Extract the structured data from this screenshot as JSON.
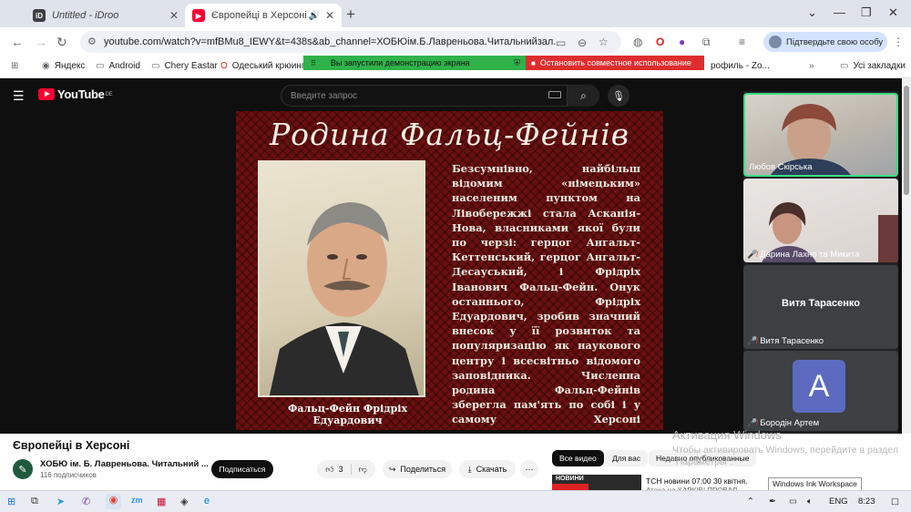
{
  "browser": {
    "tabs": [
      {
        "title": "Untitled - iDroo",
        "favicon_color": "#3c4043"
      },
      {
        "title": "Європейці в Херсоні - YouTube",
        "favicon_color": "#ff0033"
      }
    ],
    "url": "youtube.com/watch?v=mfBMu8_IEWY&t=438s&ab_channel=ХОБЮім.Б.Лавреньова.Читальнийзал.",
    "verify_label": "Підтвердьте свою особу",
    "bookmarks": [
      "Яндекс",
      "Android",
      "Chery Eastar",
      "Одеський крюинг",
      "рофиль - Zo...",
      "Усі закладки"
    ]
  },
  "share_bar": {
    "status": "Вы запустили демонстрацию экрана",
    "stop": "Остановить совместное использование",
    "status_color": "#2fb24a",
    "stop_color": "#de2d2d"
  },
  "youtube": {
    "logo": "YouTube",
    "region": "DE",
    "search_placeholder": "Введите запрос",
    "video_title": "Європейці в Херсоні",
    "channel": "ХОБЮ ім. Б. Лавреньова. Читальний ...",
    "subscribers": "116 подписчиков",
    "subscribe": "Подписаться",
    "likes": "3",
    "share": "Поделиться",
    "download": "Скачать",
    "chips": [
      "Все видео",
      "Для вас",
      "Недавно опубликованные"
    ],
    "rec_thumb_label": "НОВИНИ",
    "rec_title": "ТСН новини 07:00 30 квітня.",
    "rec_sub": "Атака на ХАРКІВ! ПРОВАЛ"
  },
  "slide": {
    "title": "Родина Фальц-Фейнів",
    "text": "Безсумнівно, найбільш відомим «німецьким» населеним пунктом на Лівобережжі стала Асканія-Нова, власниками якої були по черзі: герцог Ангальт-Кеттенський, герцог Ангальт-Десауський, і Фрідріх Іванович Фальц-Фейн. Онук останнього, Фрідріх Едуардович, зробив значний внесок у її розвиток та популяризацію як наукового центру і всесвітньо відомого заповідника. Численна родина Фальц-Фейнів зберегла пам'ять по собі і у самому Херсоні домоволодіннями, будівлею Банку для зовнішньої торгівлі, двома будівлями нічліжних притулків.",
    "caption": "Фальц-Фейн Фрідріх Едуардович"
  },
  "participants": [
    {
      "name": "Любов Скірська",
      "muted": false
    },
    {
      "name": "Дарина Лахно та Микита",
      "muted": true
    },
    {
      "name": "Витя Тарасенко",
      "muted": true,
      "center_label": "Витя Тарасенко"
    },
    {
      "name": "Бородін Артем",
      "muted": true,
      "initial": "A",
      "avatar_color": "#5c6bc0"
    }
  ],
  "windows": {
    "activate_title": "Активация Windows",
    "activate_text": "Чтобы активировать Windows, перейдите в раздел \"Параметры\".",
    "ink_tooltip": "Windows Ink Workspace",
    "lang": "ENG",
    "time": "8:23"
  }
}
